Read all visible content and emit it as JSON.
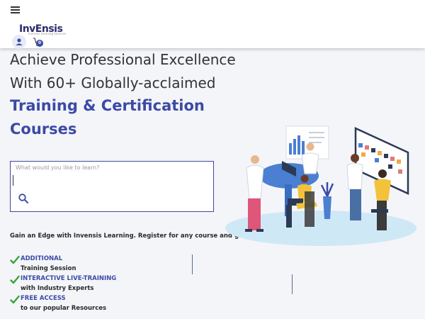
{
  "header": {
    "logo_text": "InvEnsis",
    "logo_tagline": "Invensis Learning Services",
    "cart_count": "0"
  },
  "hero": {
    "line1": "Achieve Professional Excellence",
    "line2": "With 60+ Globally-acclaimed",
    "highlight1": "Training & Certification",
    "highlight2": "Courses"
  },
  "search": {
    "placeholder": "What would you like to learn?"
  },
  "promo": {
    "text": "Gain an Edge with Invensis Learning. Register for any course and get"
  },
  "benefits": [
    {
      "title": "ADDITIONAL",
      "subtitle": "Training Session"
    },
    {
      "title": "INTERACTIVE LIVE-TRAINING",
      "subtitle": "with Industry Experts"
    },
    {
      "title": "FREE ACCESS",
      "subtitle": "to our popular Resources"
    }
  ],
  "colors": {
    "brand": "#3b4aa6",
    "check": "#3aa33a",
    "background": "#f4f5f9"
  },
  "icons": {
    "menu": "hamburger-menu-icon",
    "user": "user-icon",
    "cart": "cart-icon",
    "search": "search-icon",
    "check": "check-icon"
  }
}
